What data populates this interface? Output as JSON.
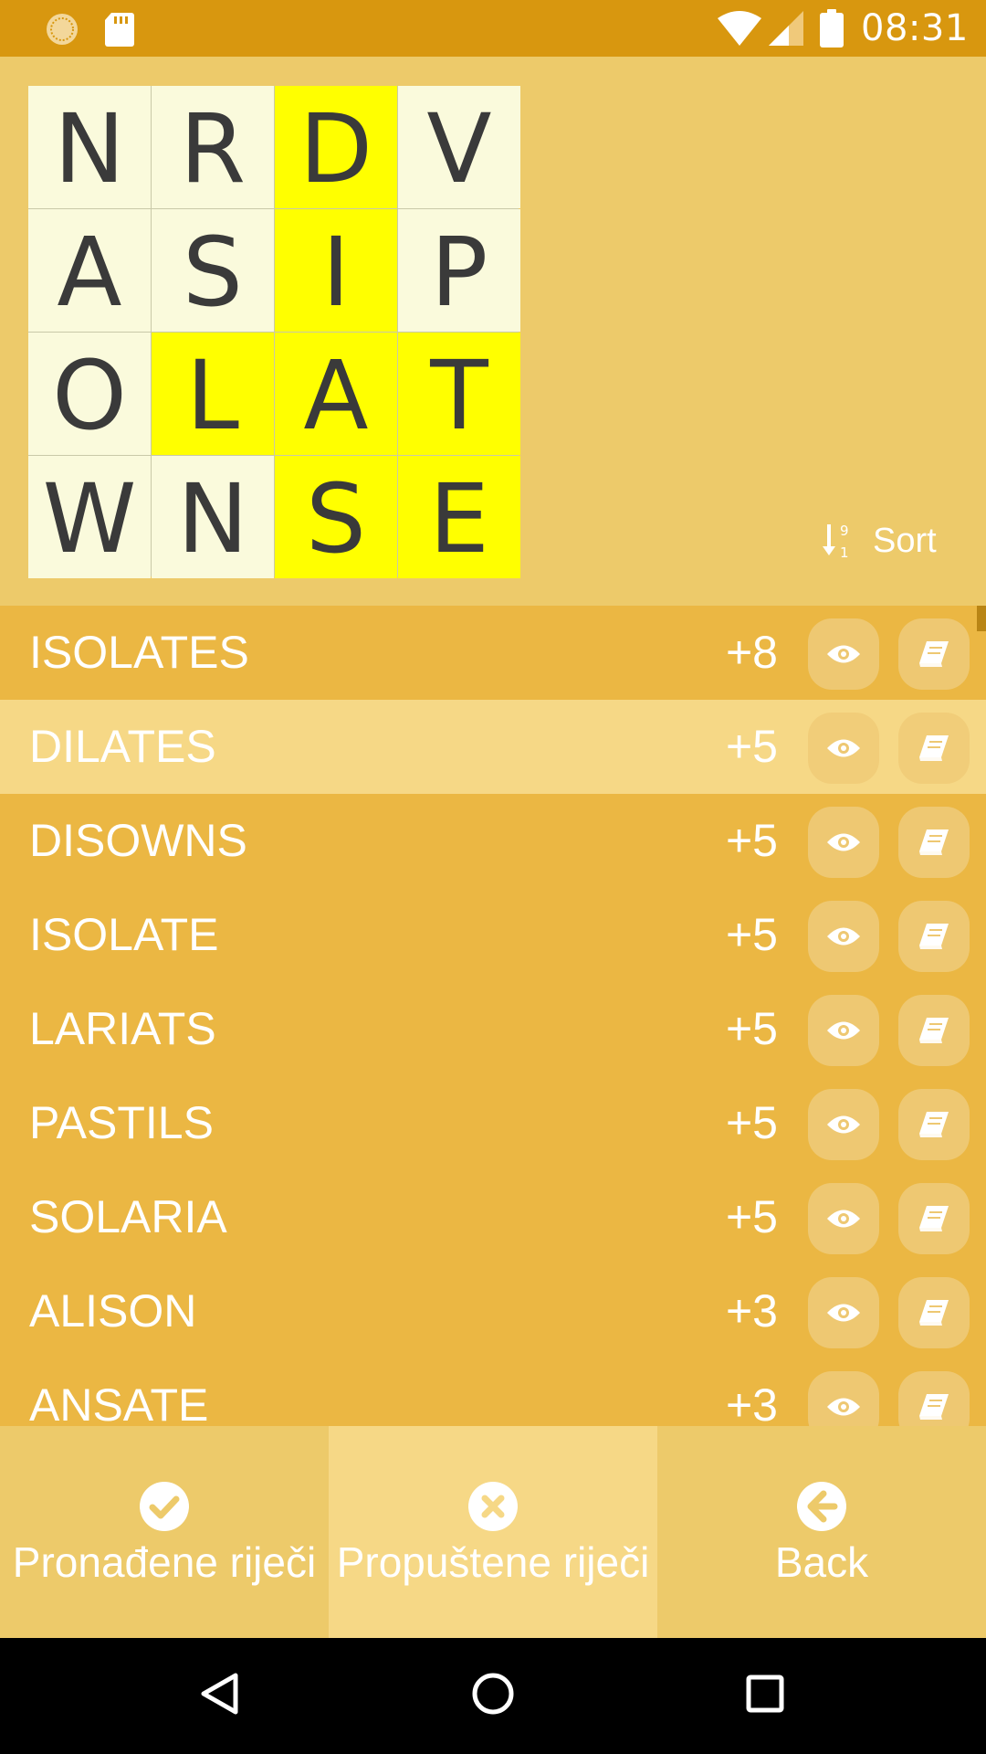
{
  "status_bar": {
    "time": "08:31",
    "icons": [
      "sync-icon",
      "sd-card-icon",
      "wifi-icon",
      "signal-icon",
      "battery-icon"
    ]
  },
  "board": {
    "rows": [
      [
        {
          "letter": "N",
          "selected": false
        },
        {
          "letter": "R",
          "selected": false
        },
        {
          "letter": "D",
          "selected": true
        },
        {
          "letter": "V",
          "selected": false
        }
      ],
      [
        {
          "letter": "A",
          "selected": false
        },
        {
          "letter": "S",
          "selected": false
        },
        {
          "letter": "I",
          "selected": true
        },
        {
          "letter": "P",
          "selected": false
        }
      ],
      [
        {
          "letter": "O",
          "selected": false
        },
        {
          "letter": "L",
          "selected": true
        },
        {
          "letter": "A",
          "selected": true
        },
        {
          "letter": "T",
          "selected": true
        }
      ],
      [
        {
          "letter": "W",
          "selected": false
        },
        {
          "letter": "N",
          "selected": false
        },
        {
          "letter": "S",
          "selected": true
        },
        {
          "letter": "E",
          "selected": true
        }
      ]
    ]
  },
  "sort": {
    "label": "Sort",
    "icon": "sort-numeric-icon"
  },
  "words": [
    {
      "word": "ISOLATES",
      "score": "+8",
      "highlighted": false
    },
    {
      "word": "DILATES",
      "score": "+5",
      "highlighted": true
    },
    {
      "word": "DISOWNS",
      "score": "+5",
      "highlighted": false
    },
    {
      "word": "ISOLATE",
      "score": "+5",
      "highlighted": false
    },
    {
      "word": "LARIATS",
      "score": "+5",
      "highlighted": false
    },
    {
      "word": "PASTILS",
      "score": "+5",
      "highlighted": false
    },
    {
      "word": "SOLARIA",
      "score": "+5",
      "highlighted": false
    },
    {
      "word": "ALISON",
      "score": "+3",
      "highlighted": false
    },
    {
      "word": "ANSATE",
      "score": "+3",
      "highlighted": false
    }
  ],
  "bottom_bar": {
    "found": {
      "label": "Pronađene riječi",
      "icon": "check-circle-icon"
    },
    "missed": {
      "label": "Propuštene riječi",
      "icon": "x-circle-icon",
      "active": true
    },
    "back": {
      "label": "Back",
      "icon": "arrow-left-circle-icon"
    }
  },
  "nav_bar": {
    "icons": [
      "back-triangle-icon",
      "home-circle-icon",
      "recents-square-icon"
    ]
  },
  "colors": {
    "status_bar": "#d8970f",
    "background": "#edca6a",
    "list_row": "#ebb743",
    "list_row_highlight": "#f6d886",
    "cell_selected": "#ffff00",
    "cell_default": "#fafadc"
  }
}
